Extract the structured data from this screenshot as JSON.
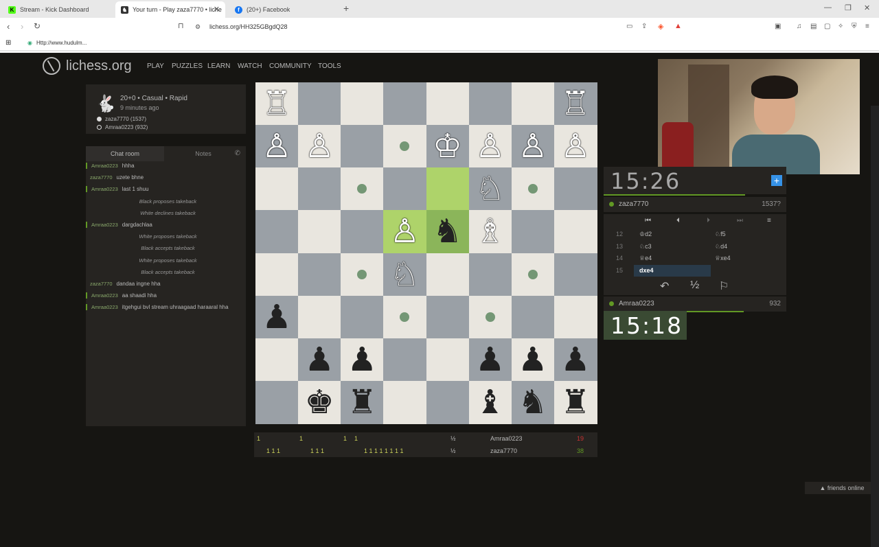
{
  "browser": {
    "tabs": [
      {
        "title": "Stream - Kick Dashboard",
        "icon": "kick-icon",
        "color": "#53fc18"
      },
      {
        "title": "Your turn - Play zaza7770 • liche",
        "icon": "lichess-icon",
        "color": "#333333"
      },
      {
        "title": "(20+) Facebook",
        "icon": "facebook-icon",
        "color": "#1877f2"
      }
    ],
    "url": "lichess.org/HH325GBgdQ28",
    "bookmark": "Http://www.hudulm..."
  },
  "site": {
    "logo": "lichess.org",
    "nav": [
      "PLAY",
      "PUZZLES",
      "LEARN",
      "WATCH",
      "COMMUNITY",
      "TOOLS"
    ]
  },
  "game_info": {
    "mode": "20+0 • Casual • Rapid",
    "ago": "9 minutes ago",
    "white": "zaza7770 (1537)",
    "black": "Amraa0223 (932)"
  },
  "chat": {
    "tabs": [
      "Chat room",
      "Notes"
    ],
    "messages": [
      {
        "who": "Amraa0223",
        "text": "hhha",
        "type": "user",
        "mark": true
      },
      {
        "who": "zaza7770",
        "text": "uzete bhne",
        "type": "user",
        "mark": false
      },
      {
        "who": "Amraa0223",
        "text": "last 1 shuu",
        "type": "user",
        "mark": true
      },
      {
        "who": "",
        "text": "Black proposes takeback",
        "type": "sys"
      },
      {
        "who": "",
        "text": "White declines takeback",
        "type": "sys"
      },
      {
        "who": "Amraa0223",
        "text": "dargdachlaa",
        "type": "user",
        "mark": true
      },
      {
        "who": "",
        "text": "White proposes takeback",
        "type": "sys"
      },
      {
        "who": "",
        "text": "Black accepts takeback",
        "type": "sys"
      },
      {
        "who": "",
        "text": "White proposes takeback",
        "type": "sys"
      },
      {
        "who": "",
        "text": "Black accepts takeback",
        "type": "sys"
      },
      {
        "who": "zaza7770",
        "text": "dandaa ingne hha",
        "type": "user",
        "mark": false
      },
      {
        "who": "Amraa0223",
        "text": "aa shaadi hha",
        "type": "user",
        "mark": true
      },
      {
        "who": "Amraa0223",
        "text": "itgehgui bvl stream uhraagaad haraaral hha",
        "type": "user",
        "mark": true
      }
    ]
  },
  "board": {
    "pieces": [
      [
        "wR",
        "",
        "",
        "",
        "",
        "",
        "",
        "wR"
      ],
      [
        "wP",
        "wP",
        "",
        "",
        "wK",
        "wP",
        "wP",
        "wP"
      ],
      [
        "",
        "",
        "",
        "",
        "",
        "wN",
        "",
        ""
      ],
      [
        "",
        "",
        "",
        "wP",
        "bN",
        "wB",
        "",
        ""
      ],
      [
        "",
        "",
        "",
        "wN",
        "",
        "",
        "",
        ""
      ],
      [
        "bP",
        "",
        "",
        "",
        "",
        "",
        "",
        ""
      ],
      [
        "",
        "bP",
        "bP",
        "",
        "",
        "bP",
        "bP",
        "bP"
      ],
      [
        "",
        "bK",
        "bR",
        "",
        "",
        "bB",
        "bN",
        "bR"
      ]
    ],
    "highlight": [
      [
        2,
        4
      ],
      [
        3,
        3
      ],
      [
        3,
        4
      ]
    ],
    "move_dots": [
      [
        1,
        3
      ],
      [
        2,
        2
      ],
      [
        2,
        6
      ],
      [
        4,
        2
      ],
      [
        4,
        6
      ],
      [
        5,
        3
      ],
      [
        5,
        5
      ]
    ]
  },
  "clocks": {
    "top_time": "15:26",
    "bottom_time": "15:18"
  },
  "players": {
    "top": {
      "name": "zaza7770",
      "rating": "1537?"
    },
    "bottom": {
      "name": "Amraa0223",
      "rating": "932"
    }
  },
  "moves": [
    {
      "n": "12",
      "w": "♔d2",
      "b": "♘f5"
    },
    {
      "n": "13",
      "w": "♘c3",
      "b": "♘d4"
    },
    {
      "n": "14",
      "w": "♕e4",
      "b": "♕xe4"
    },
    {
      "n": "15",
      "w": "dxe4",
      "b": ""
    }
  ],
  "crosstable": {
    "player_top": "Amraa0223",
    "score_top": "19",
    "player_bottom": "zaza7770",
    "score_bottom": "38"
  },
  "friends": "▲ friends online",
  "colors": {
    "accent": "#629924",
    "highlight": "#aed36a",
    "bg": "#161512",
    "panel": "#262421"
  }
}
